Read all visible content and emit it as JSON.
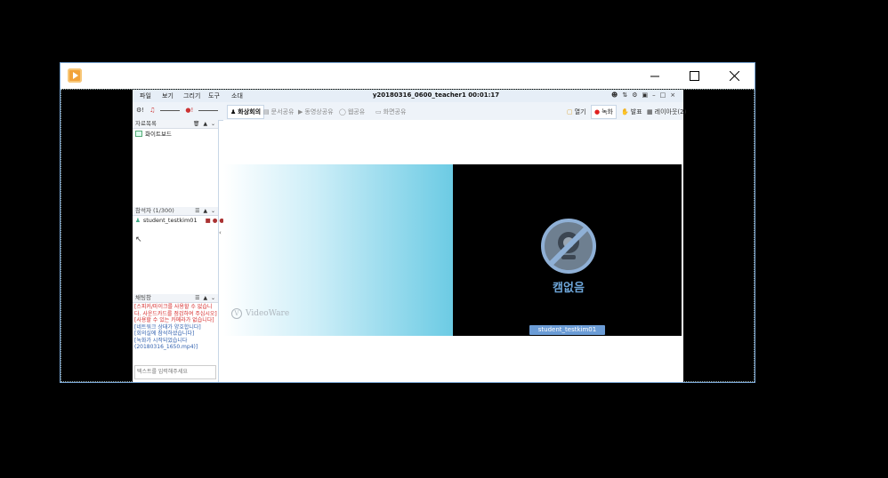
{
  "menu": [
    "파일",
    "보기",
    "그리기",
    "도구",
    "소대"
  ],
  "app_title": "y20180316_0600_teacher1 00:01:17",
  "toolbar": {
    "tabs": [
      "화상회의",
      "문서공유",
      "동영상공유",
      "웹공유",
      "화면공유"
    ],
    "right": [
      "열기",
      "녹화",
      "발표",
      "레이아웃(2)"
    ]
  },
  "panels": {
    "materials": {
      "title": "자료목록",
      "items": [
        "화이트보드"
      ]
    },
    "participants": {
      "title": "참석자 (1/300)",
      "items": [
        "student_testkim01"
      ]
    },
    "chat": {
      "title": "채팅창",
      "lines": [
        {
          "text": "[스피커/마이크를 사용할 수 없습니",
          "color": "#d62b2b"
        },
        {
          "text": "다. 사운드카드를 점검하여 주십시오]",
          "color": "#d62b2b"
        },
        {
          "text": "[사용할 수 있는 카메라가 없습니다]",
          "color": "#d62b2b"
        },
        {
          "text": "[네트워크 상태가 양호합니다]",
          "color": "#2f5fae"
        },
        {
          "text": "[회의실에 참석하셨습니다]",
          "color": "#2f5fae"
        },
        {
          "text": "[녹화가 시작되었습니다",
          "color": "#2f5fae"
        },
        {
          "text": "(20180316_1650.mp4)]",
          "color": "#2f5fae"
        }
      ],
      "placeholder": "텍스트를 입력해주세요"
    }
  },
  "video": {
    "no_camera_label": "캠없음",
    "camera_user": "student_testkim01",
    "watermark": "VideoWare"
  },
  "colors": {
    "accent": "#6b9cd6",
    "window_border": "#7aa7d6",
    "record": "#e02020"
  }
}
